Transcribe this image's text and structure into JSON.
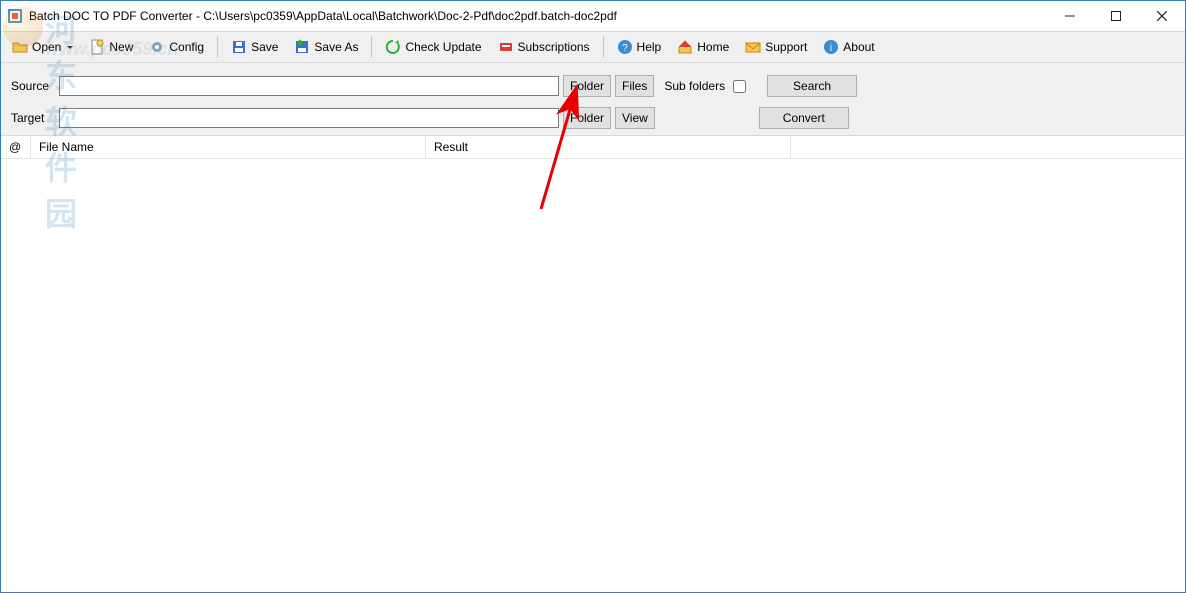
{
  "titlebar": {
    "title": "Batch DOC TO PDF Converter - C:\\Users\\pc0359\\AppData\\Local\\Batchwork\\Doc-2-Pdf\\doc2pdf.batch-doc2pdf"
  },
  "toolbar": {
    "open": "Open",
    "new": "New",
    "config": "Config",
    "save": "Save",
    "save_as": "Save As",
    "check_update": "Check Update",
    "subscriptions": "Subscriptions",
    "help": "Help",
    "home": "Home",
    "support": "Support",
    "about": "About"
  },
  "rows": {
    "source_label": "Source",
    "target_label": "Target",
    "source_value": "",
    "target_value": "",
    "folder_btn": "Folder",
    "files_btn": "Files",
    "view_btn": "View",
    "sub_folders_label": "Sub folders",
    "sub_folders_checked": false,
    "search_btn": "Search",
    "convert_btn": "Convert"
  },
  "table": {
    "col_at": "@",
    "col_filename": "File Name",
    "col_result": "Result"
  },
  "watermark": {
    "cn": "河东软件园",
    "url": "www.pc0359.cn"
  }
}
